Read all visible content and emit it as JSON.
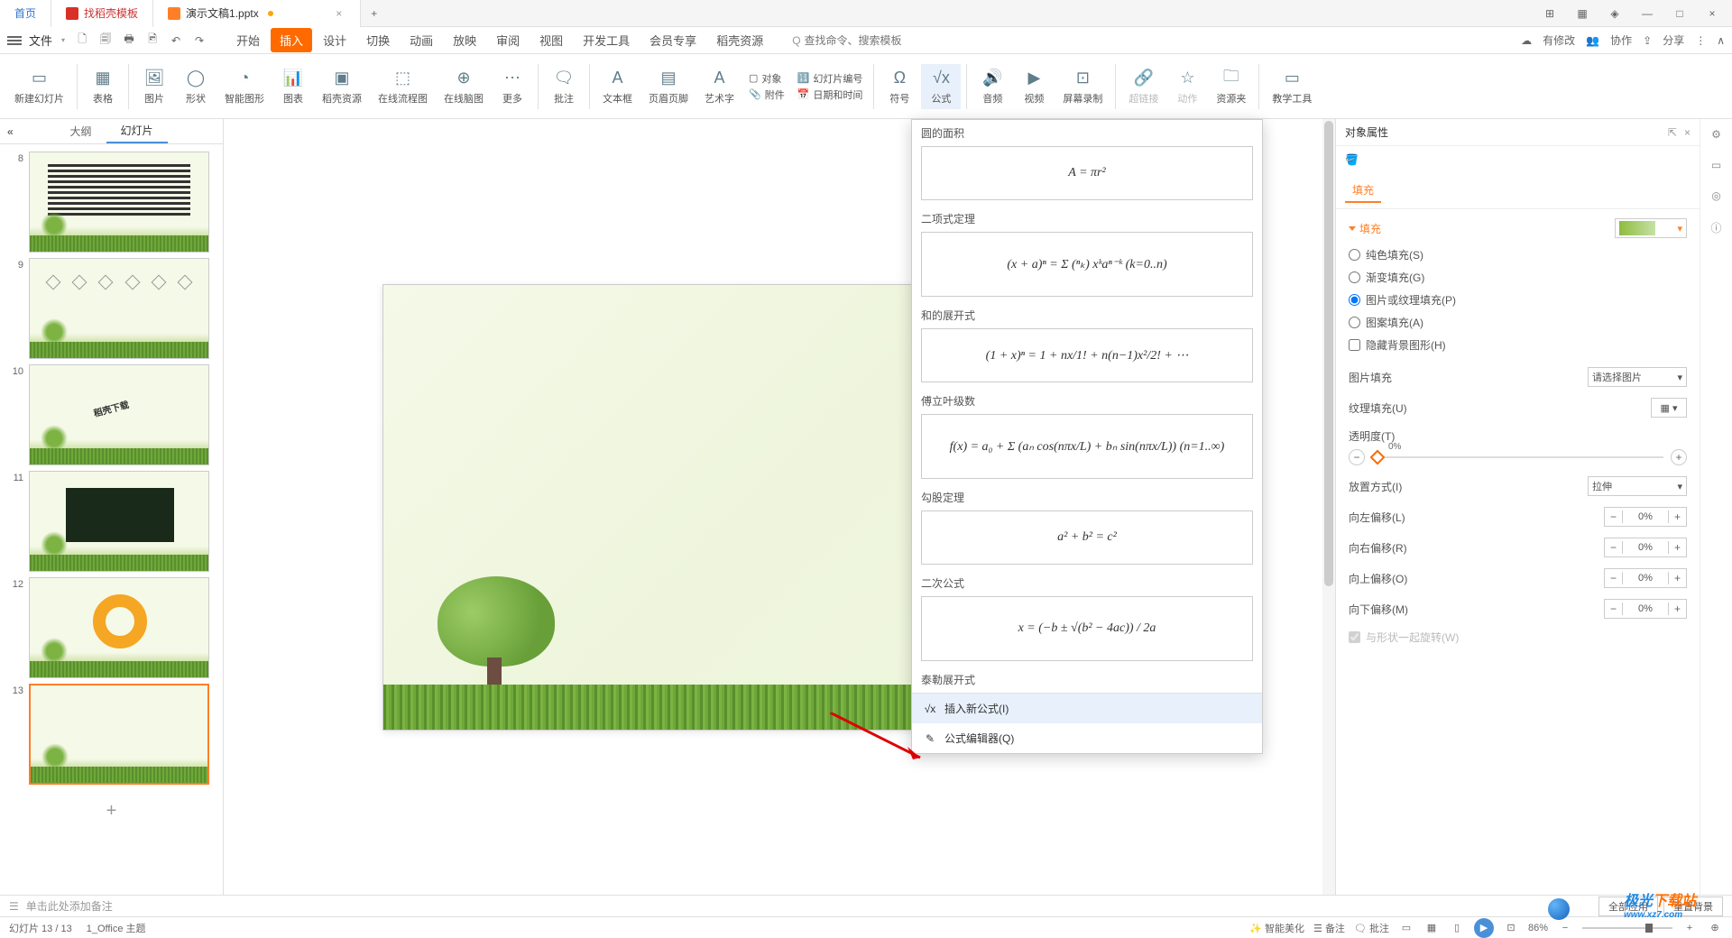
{
  "titlebar": {
    "tab_home": "首页",
    "tab_docell": "找稻壳模板",
    "tab_active": "演示文稿1.pptx",
    "close_glyph": "×",
    "add_glyph": "+",
    "icons": [
      "⊞",
      "▦",
      "◈",
      "—",
      "□",
      "×"
    ]
  },
  "menubar": {
    "file": "文件",
    "icons": [
      "🗋",
      "🗐",
      "🖶",
      "🖻",
      "↶",
      "↷"
    ],
    "tabs": [
      "开始",
      "插入",
      "设计",
      "切换",
      "动画",
      "放映",
      "审阅",
      "视图",
      "开发工具",
      "会员专享",
      "稻壳资源"
    ],
    "active_tab": "插入",
    "search_icon": "Q",
    "search_placeholder": "查找命令、搜索模板",
    "right": {
      "pending": "有修改",
      "coop": "协作",
      "share": "分享"
    }
  },
  "ribbon": {
    "items": [
      {
        "label": "新建幻灯片",
        "icon": "▭"
      },
      {
        "label": "表格",
        "icon": "▦"
      },
      {
        "label": "图片",
        "icon": "🖼"
      },
      {
        "label": "形状",
        "icon": "◯"
      },
      {
        "label": "智能图形",
        "icon": "◔"
      },
      {
        "label": "图表",
        "icon": "📊"
      },
      {
        "label": "稻壳资源",
        "icon": "▣"
      },
      {
        "label": "在线流程图",
        "icon": "⬚"
      },
      {
        "label": "在线脑图",
        "icon": "⊕"
      },
      {
        "label": "更多",
        "icon": "⋯"
      },
      {
        "label": "批注",
        "icon": "🗨"
      },
      {
        "label": "文本框",
        "icon": "A"
      },
      {
        "label": "页眉页脚",
        "icon": "▤"
      },
      {
        "label": "艺术字",
        "icon": "A"
      },
      {
        "label": "符号",
        "icon": "Ω"
      },
      {
        "label": "公式",
        "icon": "√x"
      },
      {
        "label": "音频",
        "icon": "🔊"
      },
      {
        "label": "视频",
        "icon": "▶"
      },
      {
        "label": "屏幕录制",
        "icon": "⊡"
      },
      {
        "label": "超链接",
        "icon": "🔗"
      },
      {
        "label": "动作",
        "icon": "☆"
      },
      {
        "label": "资源夹",
        "icon": "🗀"
      },
      {
        "label": "教学工具",
        "icon": "▭"
      }
    ],
    "small": {
      "object": "对象",
      "slide_num": "幻灯片编号",
      "attachment": "附件",
      "datetime": "日期和时间"
    }
  },
  "thumbs": {
    "tab_outline": "大纲",
    "tab_slides": "幻灯片",
    "collapse": "«",
    "numbers": [
      "8",
      "9",
      "10",
      "11",
      "12",
      "13"
    ],
    "text_diag": "稻壳下载",
    "add": "+"
  },
  "formula": {
    "sections": [
      {
        "title": "圆的面积",
        "formula": "A = πr²",
        "tall": false
      },
      {
        "title": "二项式定理",
        "formula": "(x + a)ⁿ = Σ (ⁿₖ) xᵏaⁿ⁻ᵏ  (k=0..n)",
        "tall": true
      },
      {
        "title": "和的展开式",
        "formula": "(1 + x)ⁿ = 1 + nx/1! + n(n−1)x²/2! + ⋯",
        "tall": false
      },
      {
        "title": "傅立叶级数",
        "formula": "f(x) = a₀ + Σ (aₙ cos(nπx/L) + bₙ sin(nπx/L))  (n=1..∞)",
        "tall": true
      },
      {
        "title": "勾股定理",
        "formula": "a² + b² = c²",
        "tall": false
      },
      {
        "title": "二次公式",
        "formula": "x = (−b ± √(b² − 4ac)) / 2a",
        "tall": true
      }
    ],
    "partial_title": "泰勒展开式",
    "insert_new": "插入新公式(I)",
    "editor": "公式编辑器(Q)",
    "insert_icon": "√x",
    "editor_icon": "✎"
  },
  "props": {
    "header": "对象属性",
    "pin": "⇱",
    "close": "×",
    "fill_tab": "填充",
    "section_title": "填充",
    "radios": {
      "solid": "纯色填充(S)",
      "gradient": "渐变填充(G)",
      "picture": "图片或纹理填充(P)",
      "pattern": "图案填充(A)",
      "hide_bg": "隐藏背景图形(H)"
    },
    "picture_fill_label": "图片填充",
    "picture_fill_value": "请选择图片",
    "texture_fill_label": "纹理填充(U)",
    "opacity_label": "透明度(T)",
    "opacity_value": "0%",
    "placement_label": "放置方式(I)",
    "placement_value": "拉伸",
    "offsets": [
      {
        "label": "向左偏移(L)",
        "value": "0%"
      },
      {
        "label": "向右偏移(R)",
        "value": "0%"
      },
      {
        "label": "向上偏移(O)",
        "value": "0%"
      },
      {
        "label": "向下偏移(M)",
        "value": "0%"
      }
    ],
    "rotate_with_shape": "与形状一起旋转(W)",
    "side_icons": [
      "⚙",
      "▭",
      "◎",
      "ⓘ"
    ]
  },
  "notes": {
    "icon": "☰",
    "placeholder": "单击此处添加备注",
    "all_apps": "全部应用",
    "reset_bg": "重置背景"
  },
  "status": {
    "slide_count": "幻灯片 13 / 13",
    "theme": "1_Office 主题",
    "smart_beautify": "智能美化",
    "notes": "备注",
    "comments": "批注",
    "zoom": "86%",
    "play": "▶"
  },
  "watermark": {
    "text1": "极光",
    "text2": "下载站",
    "url": "www.xz7.com"
  }
}
